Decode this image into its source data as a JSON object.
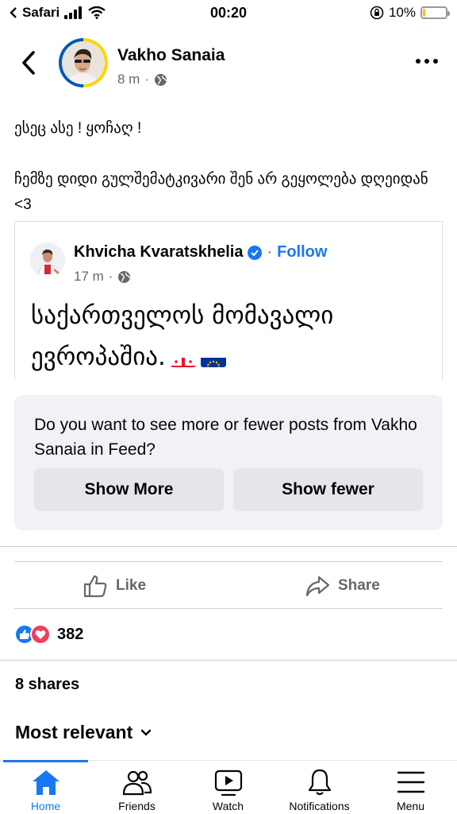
{
  "status_bar": {
    "carrier": "Safari",
    "time": "00:20",
    "battery": "10%",
    "battery_level": 0.1
  },
  "post": {
    "author": "Vakho Sanaia",
    "time": "8 m",
    "meta_separator": "·",
    "text_line1": "ესეც ასე ! ყოჩაღ !",
    "text_line2": "ჩემზე დიდი გულშემატკივარი შენ არ გეყოლება დღეიდან <3"
  },
  "shared_post": {
    "author": "Khvicha Kvaratskhelia",
    "separator": "·",
    "follow_label": "Follow",
    "time": "17 m",
    "text": "საქართველოს მომავალი ევროპაშია."
  },
  "feedback": {
    "question": "Do you want to see more or fewer posts from Vakho Sanaia in Feed?",
    "show_more": "Show More",
    "show_fewer": "Show fewer"
  },
  "actions": {
    "like": "Like",
    "share": "Share"
  },
  "reactions": {
    "count": "382"
  },
  "shares": "8 shares",
  "sort_label": "Most relevant",
  "nav": {
    "home": "Home",
    "friends": "Friends",
    "watch": "Watch",
    "notifications": "Notifications",
    "menu": "Menu"
  },
  "colors": {
    "accent": "#1877f2",
    "secondary_text": "#65676b",
    "love": "#f33e58",
    "battery_low": "#f4c20d"
  },
  "icons": [
    "back-icon",
    "more-icon",
    "globe-icon",
    "verified-icon",
    "georgia-flag-icon",
    "eu-flag-icon",
    "like-icon",
    "share-icon",
    "like-reaction-icon",
    "love-reaction-icon",
    "chevron-down-icon",
    "home-icon",
    "friends-icon",
    "watch-icon",
    "bell-icon",
    "menu-icon"
  ]
}
